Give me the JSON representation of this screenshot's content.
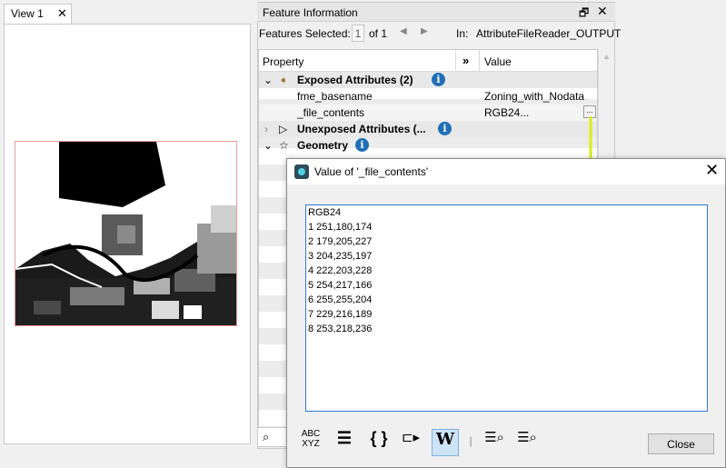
{
  "view_tab": {
    "label": "View 1",
    "close": "✕"
  },
  "feature_info": {
    "title": "Feature Information",
    "restore_icon": "restore-icon",
    "close": "✕",
    "features_selected_label": "Features Selected:",
    "selected_index": "1",
    "of_total": "of 1",
    "prev": "◀",
    "next": "▶",
    "in_label": "In:",
    "source": "AttributeFileReader_OUTPUT",
    "columns": {
      "property": "Property",
      "expand": "»",
      "value": "Value"
    },
    "rows": [
      {
        "expander": "⌄",
        "icon": "➧",
        "label": "Exposed Attributes (2)",
        "value": ""
      },
      {
        "expander": "",
        "icon": "",
        "label": "fme_basename",
        "value": "Zoning_with_Nodata"
      },
      {
        "expander": "",
        "icon": "",
        "label": "_file_contents",
        "value": "RGB24..."
      },
      {
        "expander": "›",
        "icon": "▷",
        "label": "Unexposed Attributes (...",
        "value": ""
      },
      {
        "expander": "⌄",
        "icon": "☆",
        "label": "Geometry",
        "value": ""
      }
    ],
    "ellipsis": "...",
    "info_glyph": "i",
    "search_glyph": "⌕"
  },
  "dialog": {
    "title": "Value of '_file_contents'",
    "close": "✕",
    "content_lines": [
      "RGB24",
      "1 251,180,174",
      "2 179,205,227",
      "3 204,235,197",
      "4 222,203,228",
      "5 254,217,166",
      "6 255,255,204",
      "7 229,216,189",
      "8 253,218,236"
    ],
    "toolbar": {
      "abc_top": "ABC",
      "abc_bottom": "XYZ",
      "list_glyph": "☰",
      "braces_glyph": "{ }",
      "split_glyph": "⊏▸",
      "wrap_glyph": "W",
      "sep": "|",
      "find_glyph": "☰⌕",
      "find_next_glyph": "☰⌕"
    },
    "close_button": "Close"
  },
  "colors": {
    "accent": "#1f6fb7",
    "arrow": "#d7ef18",
    "map_border": "#f29a9a"
  }
}
